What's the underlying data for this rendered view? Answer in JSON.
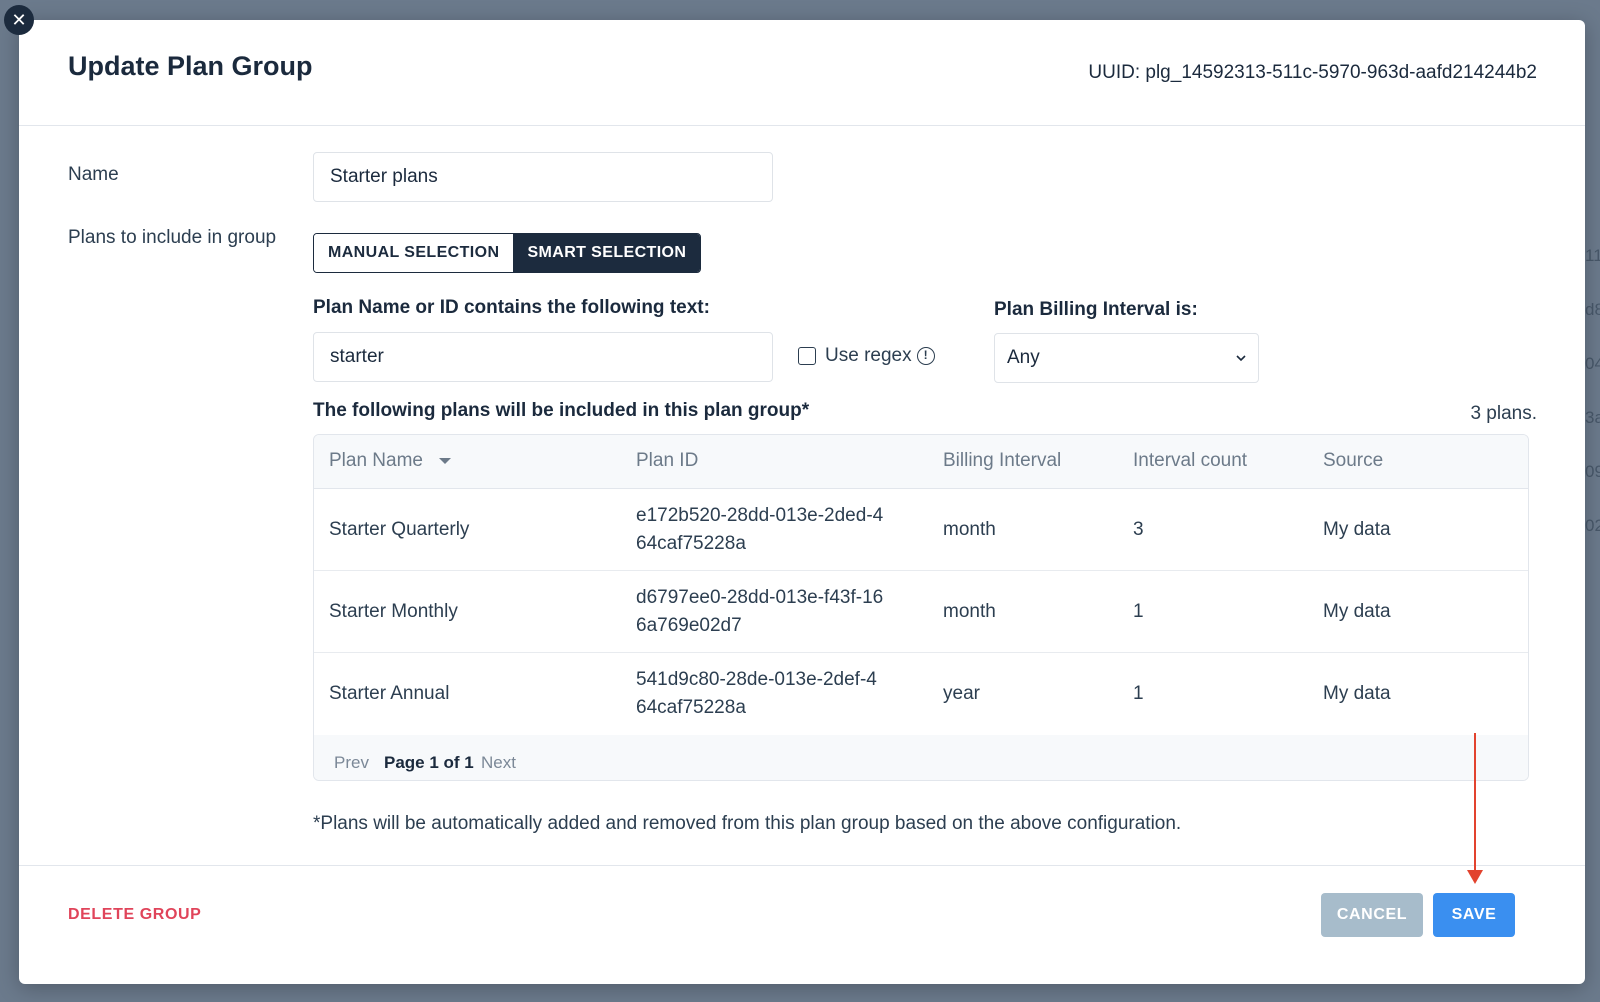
{
  "modal": {
    "title": "Update Plan Group",
    "uuid": "UUID: plg_14592313-511c-5970-963d-aafd214244b2",
    "close_icon": "close-icon"
  },
  "form": {
    "name_label": "Name",
    "name_value": "Starter plans",
    "plans_label": "Plans to include in group",
    "selection_modes": [
      "MANUAL SELECTION",
      "SMART SELECTION"
    ],
    "active_mode": "SMART SELECTION",
    "text_filter_label": "Plan Name or ID contains the following text:",
    "text_filter_value": "starter",
    "regex_label": "Use regex",
    "regex_checked": false,
    "interval_label": "Plan Billing Interval is:",
    "interval_value": "Any"
  },
  "results": {
    "heading": "The following plans will be included in this plan group*",
    "count": "3 plans.",
    "columns": [
      "Plan Name",
      "Plan ID",
      "Billing Interval",
      "Interval count",
      "Source"
    ],
    "rows": [
      {
        "name": "Starter Quarterly",
        "id": "e172b520-28dd-013e-2ded-464caf75228a",
        "interval": "month",
        "count": "3",
        "source": "My data"
      },
      {
        "name": "Starter Monthly",
        "id": "d6797ee0-28dd-013e-f43f-166a769e02d7",
        "interval": "month",
        "count": "1",
        "source": "My data"
      },
      {
        "name": "Starter Annual",
        "id": "541d9c80-28de-013e-2def-464caf75228a",
        "interval": "year",
        "count": "1",
        "source": "My data"
      }
    ],
    "pager": {
      "prev": "Prev",
      "current": "Page 1 of 1",
      "next": "Next"
    }
  },
  "footnote": "*Plans will be automatically added and removed from this plan group based on the above configuration.",
  "footer": {
    "delete_label": "DELETE GROUP",
    "cancel_label": "CANCEL",
    "save_label": "SAVE"
  },
  "background_fragments": [
    "11",
    "d8",
    "04",
    "3a",
    "09",
    "02"
  ],
  "colors": {
    "dark": "#1c2b3e",
    "primary": "#3a8ff0",
    "danger": "#e0445a",
    "cancel": "#a7bccb",
    "annotation": "#e2432e"
  }
}
